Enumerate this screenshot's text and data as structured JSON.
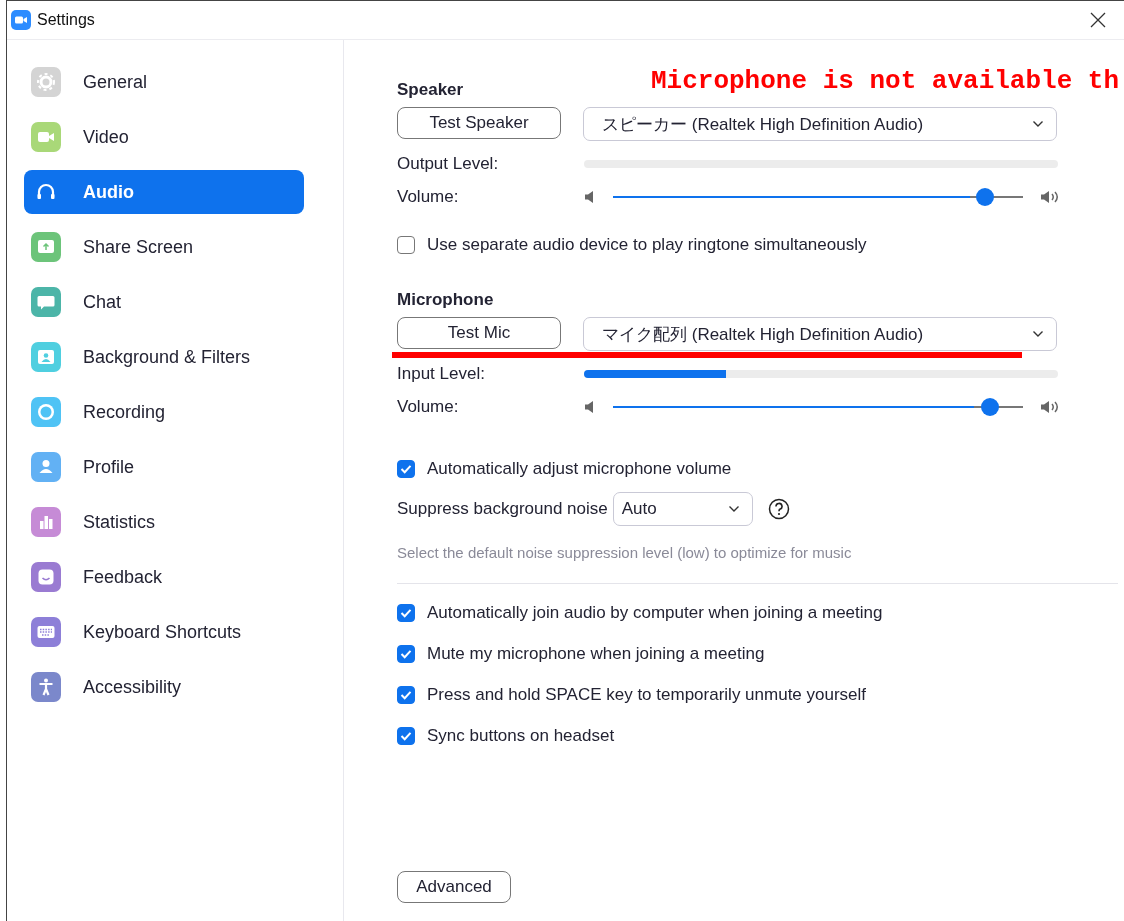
{
  "window": {
    "title": "Settings"
  },
  "sidebar": {
    "items": [
      {
        "label": "General",
        "selected": false
      },
      {
        "label": "Video",
        "selected": false
      },
      {
        "label": "Audio",
        "selected": true
      },
      {
        "label": "Share Screen",
        "selected": false
      },
      {
        "label": "Chat",
        "selected": false
      },
      {
        "label": "Background & Filters",
        "selected": false
      },
      {
        "label": "Recording",
        "selected": false
      },
      {
        "label": "Profile",
        "selected": false
      },
      {
        "label": "Statistics",
        "selected": false
      },
      {
        "label": "Feedback",
        "selected": false
      },
      {
        "label": "Keyboard Shortcuts",
        "selected": false
      },
      {
        "label": "Accessibility",
        "selected": false
      }
    ]
  },
  "speaker": {
    "heading": "Speaker",
    "test_button": "Test Speaker",
    "device": "スピーカー (Realtek High Definition Audio)",
    "level_label": "Output Level:",
    "level": 0,
    "volume_label": "Volume:",
    "volume": {
      "level": 0.87
    },
    "separate_ringtone": {
      "label": "Use separate audio device to play ringtone simultaneously",
      "checked": false
    }
  },
  "microphone": {
    "heading": "Microphone",
    "test_button": "Test Mic",
    "device": "マイク配列 (Realtek High Definition Audio)",
    "level_label": "Input Level:",
    "level": 0.3,
    "volume_label": "Volume:",
    "volume": {
      "level": 0.88
    },
    "auto_adjust": {
      "label": "Automatically adjust microphone volume",
      "checked": true
    },
    "suppress_label": "Suppress background noise",
    "suppress_value": "Auto",
    "hint": "Select the default noise suppression level (low) to optimize for music"
  },
  "options": [
    {
      "label": "Automatically join audio by computer when joining a meeting",
      "checked": true
    },
    {
      "label": "Mute my microphone when joining a meeting",
      "checked": true
    },
    {
      "label": "Press and hold SPACE key to temporarily unmute yourself",
      "checked": true
    },
    {
      "label": "Sync buttons on headset",
      "checked": true
    }
  ],
  "advanced_button": "Advanced",
  "annotation": {
    "text": "Microphone is not available th"
  }
}
